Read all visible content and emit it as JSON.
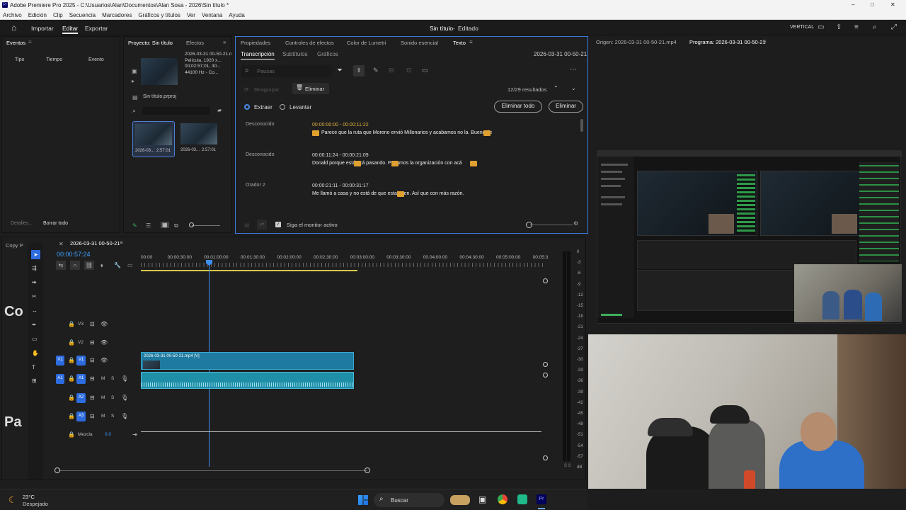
{
  "window": {
    "title": "Adobe Premiere Pro 2025 - C:\\Usuarios\\Alan\\Documentos\\Alan Sosa - 2026\\Sin título *",
    "controls": [
      "–",
      "□",
      "✕"
    ]
  },
  "menu": [
    "Archivo",
    "Edición",
    "Clip",
    "Secuencia",
    "Marcadores",
    "Gráficos y títulos",
    "Ver",
    "Ventana",
    "Ayuda"
  ],
  "appbar": {
    "workspaces": [
      "Importar",
      "Editar",
      "Exportar"
    ],
    "active": "Editar",
    "project_title": "Sin título",
    "project_state": "Editado",
    "layout": "VERTICAL"
  },
  "events_panel": {
    "tab": "Eventos",
    "columns": [
      "Tipo",
      "Tiempo",
      "Evento"
    ],
    "details": "Detalles...",
    "clear_all": "Borrar todo"
  },
  "project_panel": {
    "tabs": [
      "Proyecto: Sin título",
      "Efectos"
    ],
    "clip_name": "2026-03-31 00-50-21.mp4",
    "clip_info": [
      "Película, 1920 x...",
      "00;02:57;01, 30...",
      "44100 Hz - Co..."
    ],
    "project_file": "Sin título.prproj",
    "thumbs": [
      {
        "name": "2026-03...",
        "duration": "2:57:01"
      },
      {
        "name": "2026-03...",
        "duration": "2:57:01"
      }
    ]
  },
  "text_panel": {
    "tabs": [
      "Propiedades",
      "Controles de efectos",
      "Color de Lumetri",
      "Sonido esencial",
      "Texto"
    ],
    "active_tab": "Texto",
    "subtabs": [
      "Transcripción",
      "Subtítulos",
      "Gráficos"
    ],
    "active_subtab": "Transcripción",
    "sequence": "2026-03-31 00-50-21",
    "search_placeholder": "Pausas",
    "regroup": "Reagrupar",
    "delete": "Eliminar",
    "results": "12/29 resultados",
    "extract": "Extraer",
    "lift": "Levantar",
    "delete_all": "Eliminar todo",
    "delete_btn": "Eliminar",
    "follow_monitor": "Siga el monitor activo",
    "segments": [
      {
        "speaker": "Desconocido",
        "time": "00:00:00:00 - 00:00:11:22",
        "text": "Parece que la ruta que Moreno envió Millonarios y acabamos no la. Bueno de"
      },
      {
        "speaker": "Desconocido",
        "time": "00:00:11:24 - 00:00:21:09",
        "text": "Donald porque está acá pasando. Pasamos la organización con acá"
      },
      {
        "speaker": "Orador 2",
        "time": "00:00:21:11 - 00:00:31:17",
        "text": "Me llamó a casa y no está de que estaba en. Así que con más razón."
      }
    ]
  },
  "monitors": {
    "source": "Origen: 2026-03-31 00-50-21.mp4",
    "program": "Programa: 2026-03-31 00-50-21"
  },
  "timeline": {
    "tab": "2026-03-31 00-50-21",
    "left_tab": "Copy P",
    "timecode": "00:00:57:24",
    "ruler": [
      "00:00",
      "00:00:30:00",
      "00:01:00:00",
      "00:01:30:00",
      "00:02:00:00",
      "00:02:30:00",
      "00:03:00:00",
      "00:03:30:00",
      "00:04:00:00",
      "00:04:30:00",
      "00:05:00:00",
      "00:05:3"
    ],
    "video_tracks": [
      "V3",
      "V2",
      "V1"
    ],
    "audio_tracks": [
      "A1",
      "A2",
      "A3"
    ],
    "mix_label": "Mezcla",
    "mix_value": "0.0",
    "clip_label": "2026-03-31 00-50-21.mp4 [V]",
    "meter_scale": [
      "0",
      "-3",
      "-6",
      "-9",
      "-12",
      "-15",
      "-18",
      "-21",
      "-24",
      "-27",
      "-30",
      "-33",
      "-36",
      "-39",
      "-42",
      "-45",
      "-48",
      "-51",
      "-54",
      "-57",
      "dB"
    ],
    "solo_labels": "S  S",
    "left_overlay": [
      "Co",
      "Pa"
    ]
  },
  "taskbar": {
    "temp": "23°C",
    "weather": "Despejado",
    "search": "Buscar"
  }
}
